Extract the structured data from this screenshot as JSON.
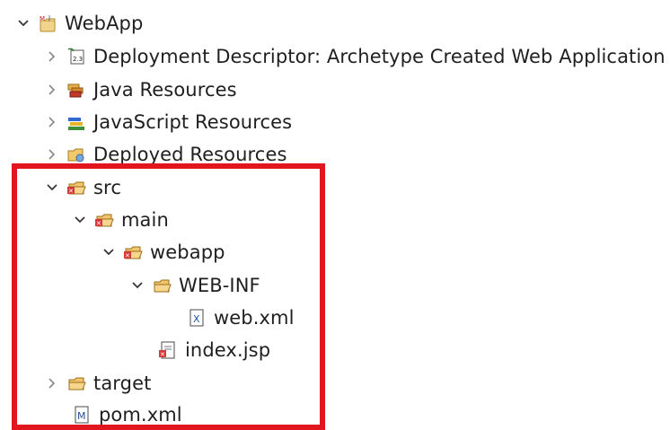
{
  "project_explorer": {
    "items": [
      {
        "label": "WebApp",
        "expanded": true,
        "icon": "maven-project-icon"
      },
      {
        "label": "Deployment Descriptor: Archetype Created Web Application",
        "expanded": false,
        "icon": "deployment-descriptor-icon"
      },
      {
        "label": "Java Resources",
        "expanded": false,
        "icon": "java-resources-icon"
      },
      {
        "label": "JavaScript Resources",
        "expanded": false,
        "icon": "javascript-resources-icon"
      },
      {
        "label": "Deployed Resources",
        "expanded": false,
        "icon": "deployed-resources-icon"
      },
      {
        "label": "src",
        "expanded": true,
        "icon": "source-folder-icon"
      },
      {
        "label": "main",
        "expanded": true,
        "icon": "source-folder-icon"
      },
      {
        "label": "webapp",
        "expanded": true,
        "icon": "source-folder-icon"
      },
      {
        "label": "WEB-INF",
        "expanded": true,
        "icon": "folder-icon"
      },
      {
        "label": "web.xml",
        "icon": "xml-file-icon"
      },
      {
        "label": "index.jsp",
        "icon": "jsp-file-icon"
      },
      {
        "label": "target",
        "expanded": false,
        "icon": "folder-icon"
      },
      {
        "label": "pom.xml",
        "icon": "maven-pom-icon"
      }
    ]
  },
  "highlight": {
    "color": "#e1161f"
  }
}
